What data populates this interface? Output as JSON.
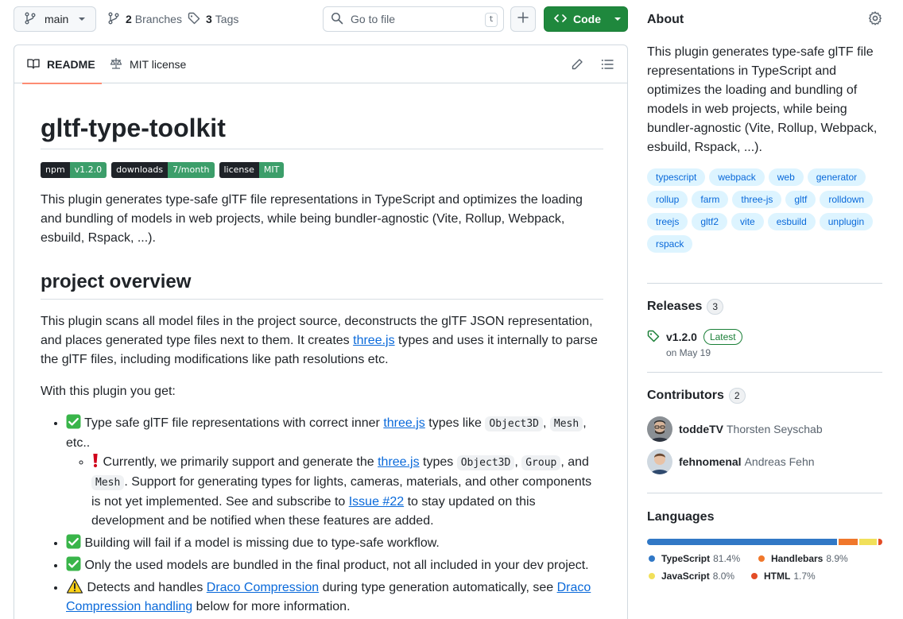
{
  "topbar": {
    "branch": "main",
    "branches_count": "2",
    "branches_label": "Branches",
    "tags_count": "3",
    "tags_label": "Tags",
    "search_placeholder": "Go to file",
    "search_shortcut": "t",
    "code_label": "Code"
  },
  "readme_tabs": {
    "readme": "README",
    "license": "MIT license"
  },
  "readme": {
    "title": "gltf-type-toolkit",
    "badges": [
      {
        "key": "npm",
        "value": "v1.2.0"
      },
      {
        "key": "downloads",
        "value": "7/month"
      },
      {
        "key": "license",
        "value": "MIT"
      }
    ],
    "intro": "This plugin generates type-safe glTF file representations in TypeScript and optimizes the loading and bundling of models in web projects, while being bundler-agnostic (Vite, Rollup, Webpack, esbuild, Rspack, ...).",
    "section_title": "project overview",
    "overview_a": "This plugin scans all model files in the project source, deconstructs the glTF JSON representation, and places generated type files next to them. It creates ",
    "overview_link": "three.js",
    "overview_b": " types and uses it internally to parse the glTF files, including modifications like path resolutions etc.",
    "with_plugin": "With this plugin you get:",
    "item1_a": " Type safe glTF file representations with correct inner ",
    "item1_link": "three.js",
    "item1_b": " types like ",
    "item1_code1": "Object3D",
    "item1_sep": ", ",
    "item1_code2": "Mesh",
    "item1_c": ", etc..",
    "sub_a": " Currently, we primarily support and generate the ",
    "sub_link": "three.js",
    "sub_b": " types ",
    "sub_code1": "Object3D",
    "sub_sep": ", ",
    "sub_code2": "Group",
    "sub_c": ", and ",
    "sub_code3": "Mesh",
    "sub_d": ". Support for generating types for lights, cameras, materials, and other components is not yet implemented. See and subscribe to ",
    "sub_link2": "Issue #22",
    "sub_e": " to stay updated on this development and be notified when these features are added.",
    "item2": " Building will fail if a model is missing due to type-safe workflow.",
    "item3": " Only the used models are bundled in the final product, not all included in your dev project.",
    "item4_a": " Detects and handles ",
    "item4_link": "Draco Compression",
    "item4_b": " during type generation automatically, see ",
    "item4_link2": "Draco Compression handling",
    "item4_c": " below for more information."
  },
  "about": {
    "heading": "About",
    "description": "This plugin generates type-safe glTF file representations in TypeScript and optimizes the loading and bundling of models in web projects, while being bundler-agnostic (Vite, Rollup, Webpack, esbuild, Rspack, ...).",
    "topics": [
      "typescript",
      "webpack",
      "web",
      "generator",
      "rollup",
      "farm",
      "three-js",
      "gltf",
      "rolldown",
      "treejs",
      "gltf2",
      "vite",
      "esbuild",
      "unplugin",
      "rspack"
    ]
  },
  "releases": {
    "heading": "Releases",
    "count": "3",
    "version": "v1.2.0",
    "badge": "Latest",
    "date": "on May 19"
  },
  "contributors": {
    "heading": "Contributors",
    "count": "2",
    "list": [
      {
        "login": "toddeTV",
        "name": "Thorsten Seyschab"
      },
      {
        "login": "fehnomenal",
        "name": "Andreas Fehn"
      }
    ]
  },
  "languages": {
    "heading": "Languages",
    "list": [
      {
        "name": "TypeScript",
        "percent": "81.4%",
        "value": 81.4,
        "color": "#3178c6"
      },
      {
        "name": "Handlebars",
        "percent": "8.9%",
        "value": 8.9,
        "color": "#f0772b"
      },
      {
        "name": "JavaScript",
        "percent": "8.0%",
        "value": 8.0,
        "color": "#f1e05a"
      },
      {
        "name": "HTML",
        "percent": "1.7%",
        "value": 1.7,
        "color": "#e34c26"
      }
    ]
  }
}
